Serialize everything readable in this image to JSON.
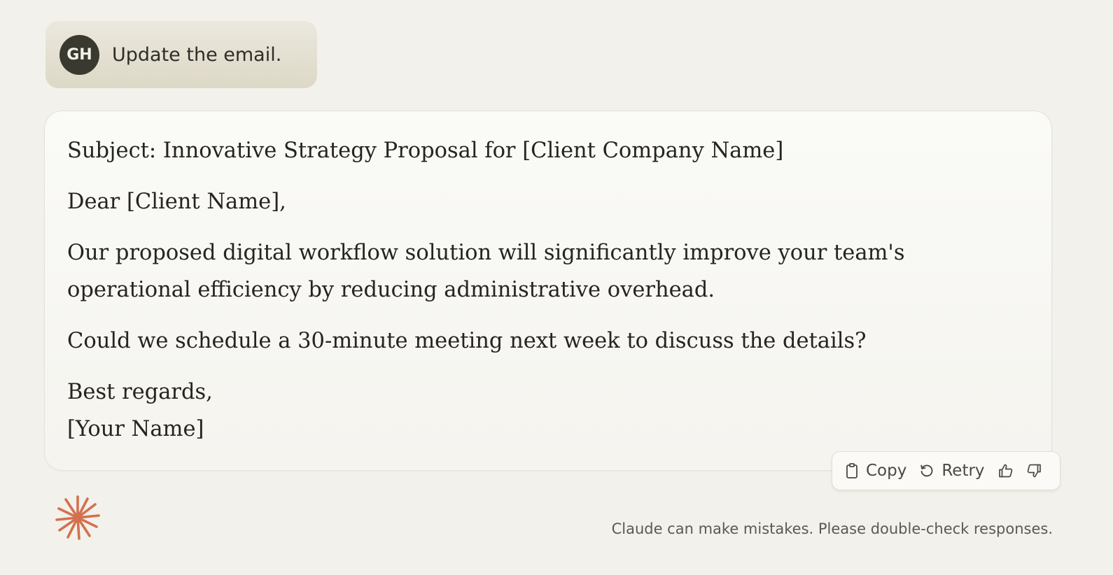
{
  "user_message": {
    "avatar_initials": "GH",
    "text": "Update the email."
  },
  "response": {
    "subject": "Subject: Innovative Strategy Proposal for [Client Company Name]",
    "greeting": "Dear [Client Name],",
    "body_1": "Our proposed digital workflow solution will significantly improve your team's operational efficiency by reducing administrative overhead.",
    "body_2": "Could we schedule a 30-minute meeting next week to discuss the details?",
    "closing": "Best regards,",
    "signature": "[Your Name]"
  },
  "actions": {
    "copy_label": "Copy",
    "retry_label": "Retry",
    "copy_icon": "clipboard-icon",
    "retry_icon": "retry-icon",
    "thumbs_up_icon": "thumbs-up-icon",
    "thumbs_down_icon": "thumbs-down-icon"
  },
  "footer": {
    "disclaimer": "Claude can make mistakes. Please double-check responses."
  },
  "colors": {
    "background": "#f3f1eb",
    "logo_accent": "#d4704f",
    "avatar_bg": "#3a3930"
  }
}
